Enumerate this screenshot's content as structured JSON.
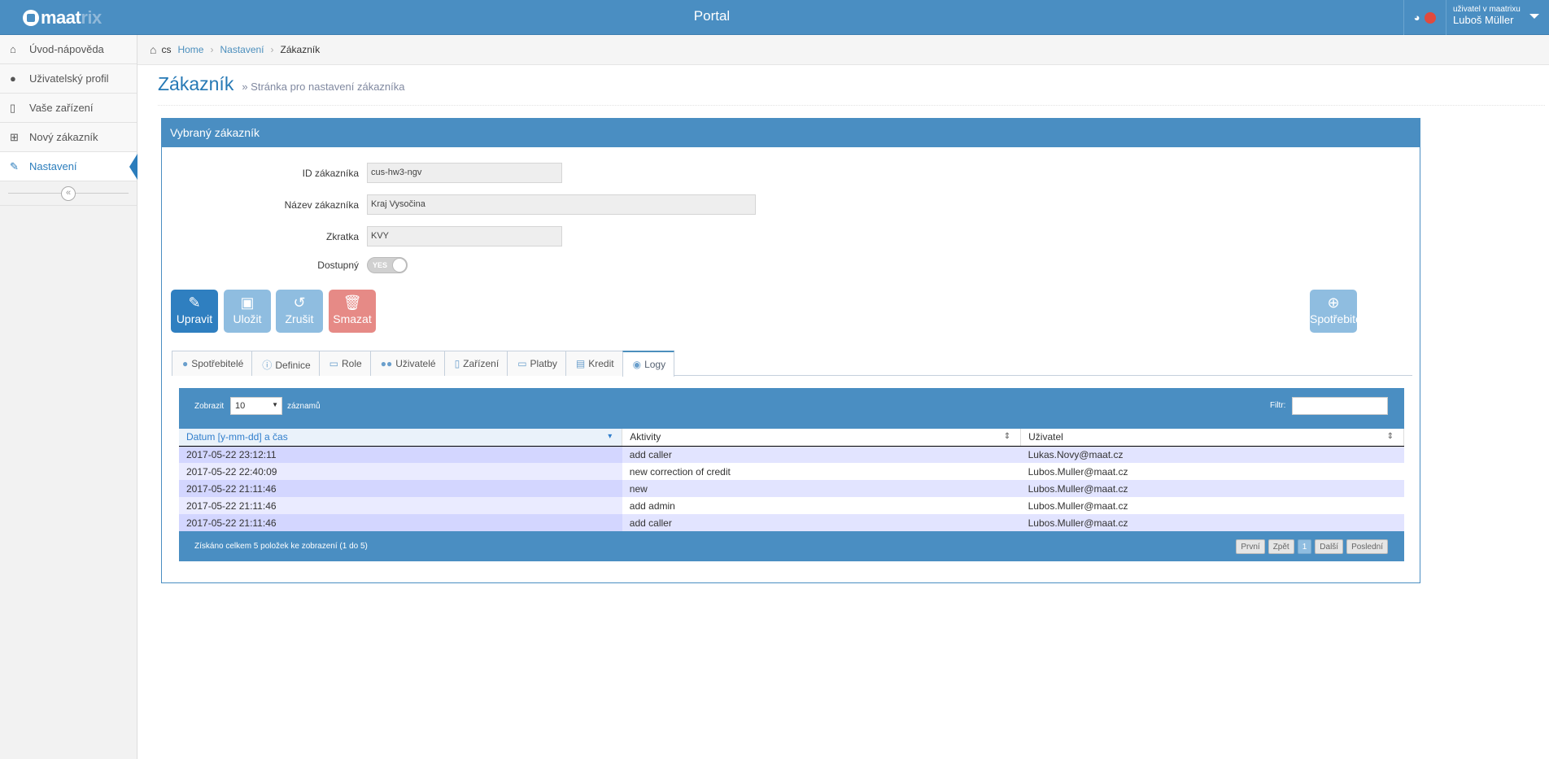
{
  "app": {
    "logo_main": "maat",
    "logo_suffix": "rix",
    "title": "Portal",
    "user_caption": "uživatel v maatrixu",
    "user_name": "Luboš Müller"
  },
  "sidebar": {
    "items": [
      {
        "label": "Úvod-nápověda",
        "icon": "home-icon"
      },
      {
        "label": "Uživatelský profil",
        "icon": "user-icon"
      },
      {
        "label": "Vaše zařízení",
        "icon": "mobile-icon"
      },
      {
        "label": "Nový zákazník",
        "icon": "cart-icon"
      },
      {
        "label": "Nastavení",
        "icon": "wrench-icon"
      }
    ],
    "collapse": "«"
  },
  "breadcrumb": {
    "lang": "cs",
    "home": "Home",
    "settings": "Nastavení",
    "current": "Zákazník"
  },
  "page": {
    "title": "Zákazník",
    "subtitle": "» Stránka pro nastavení zákazníka"
  },
  "panel": {
    "title": "Vybraný zákazník",
    "fields": {
      "id_label": "ID zákazníka",
      "id_value": "cus-hw3-ngv",
      "name_label": "Název zákazníka",
      "name_value": "Kraj Vysočina",
      "abbr_label": "Zkratka",
      "abbr_value": "KVY",
      "available_label": "Dostupný",
      "available_toggle": "YES"
    },
    "buttons": {
      "edit": "Upravit",
      "save": "Uložit",
      "cancel": "Zrušit",
      "delete": "Smazat",
      "consumers": "Spotřebitel"
    },
    "tabs": [
      "Spotřebitelé",
      "Definice",
      "Role",
      "Uživatelé",
      "Zařízení",
      "Platby",
      "Kredit",
      "Logy"
    ]
  },
  "logs": {
    "show_label": "Zobrazit",
    "show_value": "10",
    "records_label": "záznamů",
    "filter_label": "Filtr:",
    "columns": [
      "Datum [y-mm-dd] a čas",
      "Aktivity",
      "Uživatel"
    ],
    "rows": [
      [
        "2017-05-22 23:12:11",
        "add caller",
        "Lukas.Novy@maat.cz"
      ],
      [
        "2017-05-22 22:40:09",
        "new correction of credit",
        "Lubos.Muller@maat.cz"
      ],
      [
        "2017-05-22 21:11:46",
        "new",
        "Lubos.Muller@maat.cz"
      ],
      [
        "2017-05-22 21:11:46",
        "add admin",
        "Lubos.Muller@maat.cz"
      ],
      [
        "2017-05-22 21:11:46",
        "add caller",
        "Lubos.Muller@maat.cz"
      ]
    ],
    "footer_info": "Získáno celkem 5 položek ke zobrazení (1 do 5)",
    "pager": {
      "first": "První",
      "prev": "Zpět",
      "page": "1",
      "next": "Další",
      "last": "Poslední"
    }
  },
  "colors": {
    "accent": "#4a8ec2",
    "link": "#2679b5",
    "danger": "#e68a86"
  }
}
